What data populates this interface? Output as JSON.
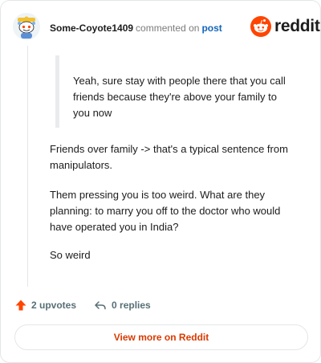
{
  "comment": {
    "username": "Some-Coyote1409",
    "action_text": "commented on",
    "post_link": "post",
    "quote": "Yeah, sure stay with people there that you call friends because they're above your family to you now",
    "paragraphs": [
      "Friends over family -> that's a typical sentence from manipulators.",
      "Them pressing you is too weird. What are they planning: to marry you off to the doctor who would have operated you in India?",
      "So weird"
    ]
  },
  "brand": {
    "wordmark": "reddit",
    "accent_color": "#FF4500"
  },
  "footer": {
    "upvotes": "2 upvotes",
    "replies": "0 replies",
    "view_more": "View more on Reddit"
  }
}
